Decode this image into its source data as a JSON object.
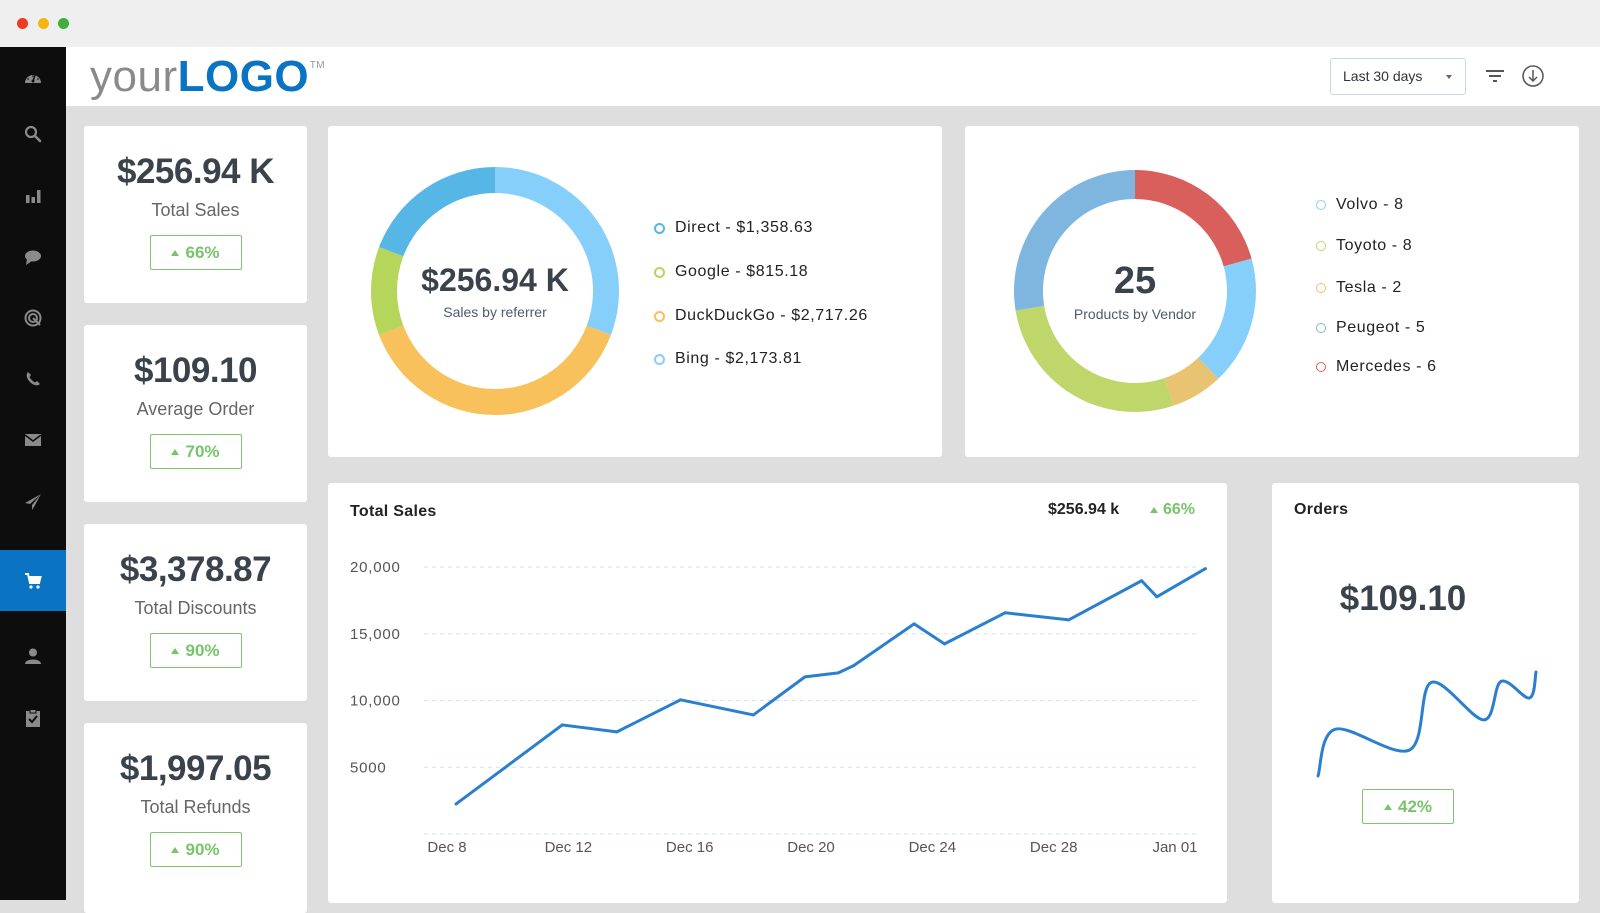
{
  "window": {
    "controls": [
      "close",
      "minimize",
      "maximize"
    ]
  },
  "sidebar": {
    "items": [
      {
        "name": "dashboard",
        "icon": "dashboard-gauge-icon",
        "active": false
      },
      {
        "name": "search",
        "icon": "search-icon",
        "active": false
      },
      {
        "name": "reports",
        "icon": "bar-chart-icon",
        "active": false
      },
      {
        "name": "chat",
        "icon": "chat-bubble-icon",
        "active": false
      },
      {
        "name": "targeting",
        "icon": "target-icon",
        "active": false
      },
      {
        "name": "calls",
        "icon": "phone-icon",
        "active": false
      },
      {
        "name": "mail",
        "icon": "envelope-icon",
        "active": false
      },
      {
        "name": "campaigns",
        "icon": "paper-plane-icon",
        "active": false
      },
      {
        "name": "ecommerce",
        "icon": "shopping-cart-icon",
        "active": true
      },
      {
        "name": "contacts",
        "icon": "user-icon",
        "active": false
      },
      {
        "name": "tasks",
        "icon": "clipboard-check-icon",
        "active": false
      }
    ],
    "accent": "#0a73c2"
  },
  "header": {
    "logo_prefix": "your",
    "logo_brand": "LOGO",
    "logo_tm": "TM",
    "date_range": "Last 30 days",
    "filter_icon": "filter-icon",
    "download_icon": "download-circle-icon"
  },
  "kpis": [
    {
      "value": "$256.94 K",
      "label": "Total Sales",
      "change": "66%",
      "direction": "up"
    },
    {
      "value": "$109.10",
      "label": "Average Order",
      "change": "70%",
      "direction": "up"
    },
    {
      "value": "$3,378.87",
      "label": "Total Discounts",
      "change": "90%",
      "direction": "up"
    },
    {
      "value": "$1,997.05",
      "label": "Total Refunds",
      "change": "90%",
      "direction": "up"
    }
  ],
  "referrer": {
    "center_value": "$256.94 K",
    "center_label": "Sales by referrer",
    "legend": [
      {
        "text": "Direct - $1,358.63",
        "color": "#56b6e6"
      },
      {
        "text": "Google - $815.18",
        "color": "#b5d65a"
      },
      {
        "text": "DuckDuckGo - $2,717.26",
        "color": "#f8c15c"
      },
      {
        "text": "Bing - $2,173.81",
        "color": "#87cffb"
      }
    ]
  },
  "vendor": {
    "center_value": "25",
    "center_label": "Products by Vendor",
    "legend": [
      {
        "text": "Volvo - 8",
        "color": "#7fb6e0"
      },
      {
        "text": "Toyoto - 8",
        "color": "#bfd66a"
      },
      {
        "text": "Tesla - 2",
        "color": "#e8c372"
      },
      {
        "text": "Peugeot - 5",
        "color": "#87cffb"
      },
      {
        "text": "Mercedes - 6",
        "color": "#d95f5d"
      }
    ]
  },
  "total_sales": {
    "title": "Total Sales",
    "total": "$256.94 k",
    "change": "66%"
  },
  "orders": {
    "title": "Orders",
    "value": "$109.10",
    "change": "42%"
  },
  "chart_data": [
    {
      "type": "pie",
      "variant": "donut",
      "title": "Sales by referrer",
      "categories": [
        "Bing",
        "DuckDuckGo",
        "Google",
        "Direct"
      ],
      "values": [
        2173.81,
        2717.26,
        815.18,
        1358.63
      ],
      "colors": [
        "#87cffb",
        "#f8c15c",
        "#b5d65a",
        "#56b6e6"
      ],
      "center_text": "$256.94 K",
      "legend": "right"
    },
    {
      "type": "pie",
      "variant": "donut",
      "title": "Products by Vendor",
      "categories": [
        "Mercedes",
        "Peugeot",
        "Tesla",
        "Toyoto",
        "Volvo"
      ],
      "values": [
        6,
        5,
        2,
        8,
        8
      ],
      "colors": [
        "#d95f5d",
        "#87cffb",
        "#e8c372",
        "#bfd66a",
        "#7fb6e0"
      ],
      "center_text": "25",
      "legend": "right"
    },
    {
      "type": "line",
      "title": "Total Sales",
      "x": [
        8.3,
        11.8,
        13.6,
        15.7,
        18.1,
        19.8,
        20.9,
        21.4,
        23.4,
        24.4,
        26.4,
        28.5,
        30.9,
        31.4,
        33.0
      ],
      "x_unit": "day of period (Dec 8 = 8, Jan 01 = 32)",
      "values": [
        2250,
        8170,
        7650,
        10050,
        8920,
        11770,
        12070,
        12600,
        15740,
        14240,
        16570,
        16040,
        18970,
        17770,
        19870
      ],
      "xticks": [
        8,
        12,
        16,
        20,
        24,
        28,
        32
      ],
      "xtick_labels": [
        "Dec 8",
        "Dec 12",
        "Dec 16",
        "Dec 20",
        "Dec 24",
        "Dec 28",
        "Jan 01"
      ],
      "yticks": [
        5000,
        10000,
        15000,
        20000
      ],
      "ytick_labels": [
        "5000",
        "10,000",
        "15,000",
        "20,000"
      ],
      "ylim": [
        0,
        20000
      ],
      "grid": true,
      "color": "#2a7fcf",
      "xlabel": "",
      "ylabel": ""
    },
    {
      "type": "line",
      "title": "Orders",
      "variant": "sparkline",
      "x": [
        0,
        0.08,
        0.42,
        0.52,
        0.76,
        0.84,
        0.97,
        1.0
      ],
      "values": [
        0.0,
        0.45,
        0.25,
        0.9,
        0.54,
        0.91,
        0.75,
        1.0
      ],
      "value_unit": "relative",
      "color": "#2a7fcf"
    }
  ]
}
